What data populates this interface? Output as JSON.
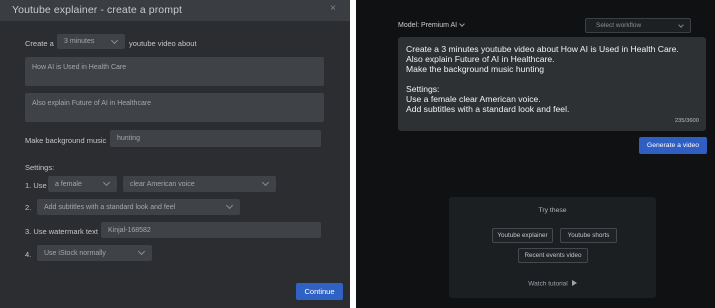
{
  "modal": {
    "title": "Youtube explainer - create a prompt",
    "close_icon": "×",
    "create_prefix": "Create a",
    "duration_value": "3 minutes",
    "create_suffix": "youtube video about",
    "topic_value": "How AI is Used in Health Care",
    "extra_value": "Also explain Future of AI in Healthcare",
    "music_label": "Make background music",
    "music_value": "hunting",
    "settings_label": "Settings:",
    "setting1_label": "1. Use",
    "voice_gender_value": "a female",
    "voice_type_value": "clear American voice",
    "setting2_label": "2.",
    "subtitles_value": "Add subtitles with a standard look and feel",
    "setting3_label": "3. Use watermark text",
    "watermark_value": "Kinjal-168582",
    "setting4_label": "4.",
    "istock_value": "Use iStock normally",
    "continue_label": "Continue"
  },
  "panel": {
    "model_label": "Model: Premium AI",
    "workflow_placeholder": "Select workflow",
    "prompt_lines": [
      "Create a 3 minutes youtube video about How AI is Used in Health Care.",
      "Also explain Future of AI in Healthcare.",
      "Make the background music hunting",
      "",
      "Settings:",
      "Use a female clear American voice.",
      "Add subtitles with a standard look and feel."
    ],
    "char_count": "235/3600",
    "generate_label": "Generate a video",
    "try_title": "Try these",
    "chips": [
      "Youtube explainer",
      "Youtube shorts",
      "Recent events video"
    ],
    "watch_label": "Watch tutorial"
  },
  "icons": {
    "close": "close-icon",
    "dropdown": "chevron-down-icon",
    "play": "play-icon"
  },
  "colors": {
    "modal_bg": "#2b2d30",
    "field_bg": "#3f4246",
    "accent": "#2f62c4",
    "right_bg": "#0f1113"
  }
}
